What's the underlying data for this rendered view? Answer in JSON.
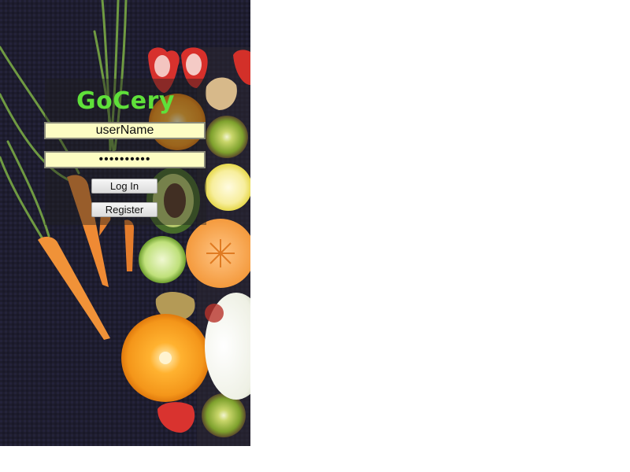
{
  "app": {
    "brand": "GoCery"
  },
  "login_form": {
    "username_value": "userName",
    "password_value": "••••••••••",
    "login_label": "Log In",
    "register_label": "Register"
  },
  "colors": {
    "brand_green": "#5fe03a",
    "field_background": "#fdfdc3",
    "backdrop": "#1c1b2b"
  }
}
